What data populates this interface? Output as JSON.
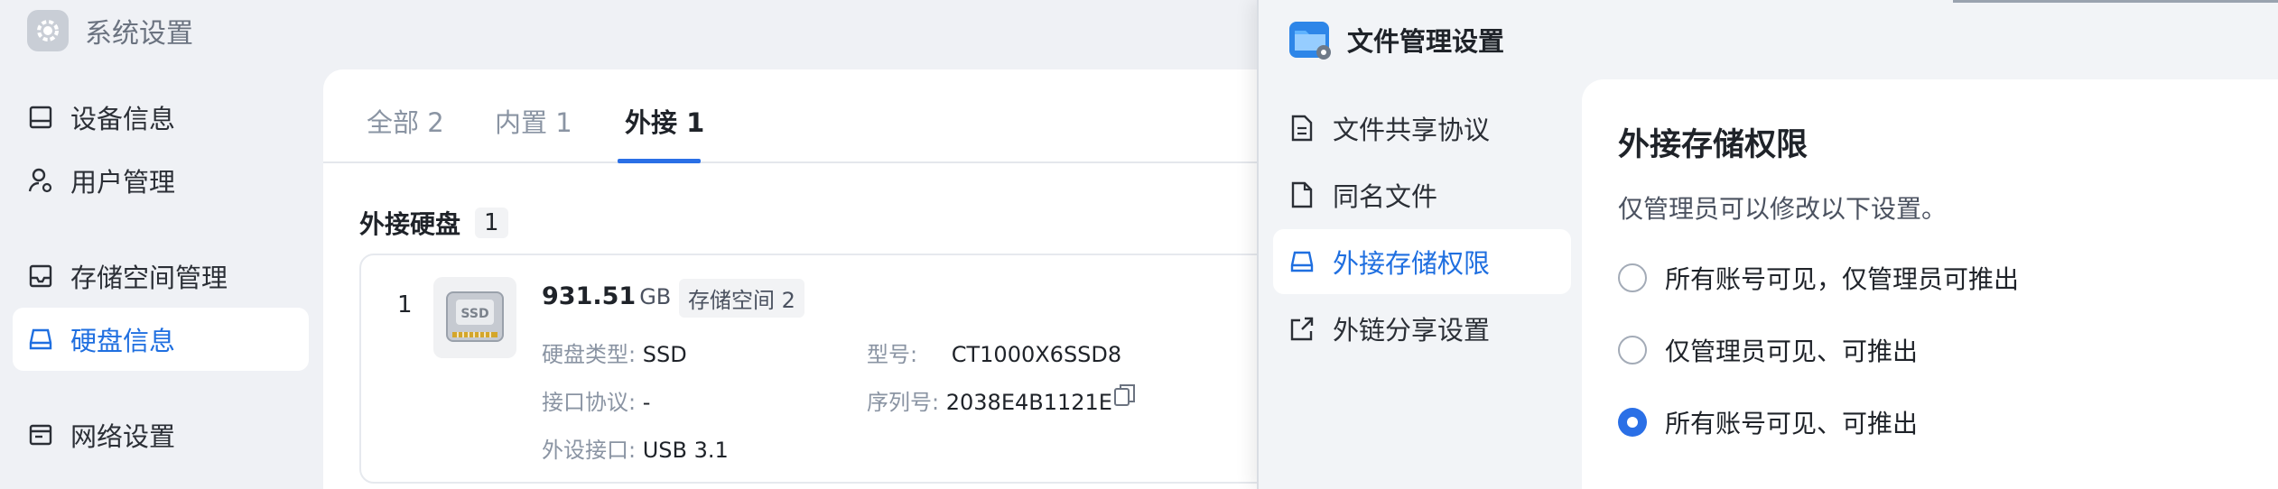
{
  "system": {
    "title": "系统设置",
    "nav": [
      {
        "label": "设备信息",
        "icon": "device-info-icon"
      },
      {
        "label": "用户管理",
        "icon": "user-icon"
      },
      {
        "label": "存储空间管理",
        "icon": "storage-icon"
      },
      {
        "label": "硬盘信息",
        "icon": "disk-icon"
      },
      {
        "label": "网络设置",
        "icon": "network-icon"
      }
    ],
    "active_nav": "硬盘信息",
    "tabs": [
      "全部 2",
      "内置 1",
      "外接 1"
    ],
    "active_tab": "外接 1",
    "section": {
      "title": "外接硬盘",
      "count": "1"
    },
    "disk": {
      "index": "1",
      "image_text": "SSD",
      "size": "931.51",
      "unit": "GB",
      "pool": "存储空间 2",
      "type_label": "硬盘类型:",
      "type_value": "SSD",
      "model_label": "型号:",
      "model_value": "CT1000X6SSD8",
      "protocol_label": "接口协议:",
      "protocol_value": "-",
      "serial_label": "序列号:",
      "serial_value": "2038E4B1121E",
      "port_label": "外设接口:",
      "port_value": "USB 3.1"
    }
  },
  "file_manager": {
    "title": "文件管理设置",
    "nav": [
      {
        "label": "文件共享协议",
        "icon": "document-icon"
      },
      {
        "label": "同名文件",
        "icon": "file-icon"
      },
      {
        "label": "外接存储权限",
        "icon": "external-drive-icon"
      },
      {
        "label": "外链分享设置",
        "icon": "share-icon"
      }
    ],
    "active_nav": "外接存储权限",
    "panel": {
      "title": "外接存储权限",
      "description": "仅管理员可以修改以下设置。",
      "options": [
        {
          "label": "所有账号可见，仅管理员可推出",
          "checked": false
        },
        {
          "label": "仅管理员可见、可推出",
          "checked": false
        },
        {
          "label": "所有账号可见、可推出",
          "checked": true
        }
      ]
    }
  },
  "colors": {
    "accent": "#2a6fe6",
    "active_text": "#1f6fe0",
    "muted": "#8a94a3"
  }
}
